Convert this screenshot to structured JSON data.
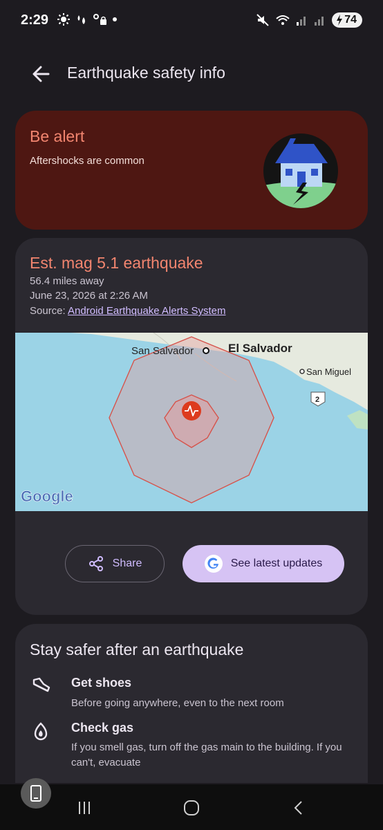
{
  "status_bar": {
    "time": "2:29",
    "battery": "74"
  },
  "app_bar": {
    "title": "Earthquake safety info"
  },
  "alert": {
    "title": "Be alert",
    "subtitle": "Aftershocks are common"
  },
  "quake": {
    "title": "Est. mag 5.1 earthquake",
    "distance": "56.4 miles away",
    "datetime": "June 23, 2026 at 2:26 AM",
    "source_prefix": "Source: ",
    "source_link": "Android Earthquake Alerts System"
  },
  "map": {
    "label_san_salvador": "San Salvador",
    "label_el_salvador": "El Salvador",
    "label_san_miguel": "San Miguel",
    "road_shield": "2",
    "google_logo": "Google"
  },
  "buttons": {
    "share": "Share",
    "updates": "See latest updates"
  },
  "safety": {
    "title": "Stay safer after an earthquake",
    "tips": [
      {
        "title": "Get shoes",
        "desc": "Before going anywhere, even to the next room"
      },
      {
        "title": "Check gas",
        "desc": "If you smell gas, turn off the gas main to the building. If you can't, evacuate"
      }
    ]
  },
  "colors": {
    "alert_bg": "#4e1712",
    "accent_red": "#f2856f",
    "primary_light": "#d6c3f4",
    "map_water": "#9bd3e6"
  }
}
